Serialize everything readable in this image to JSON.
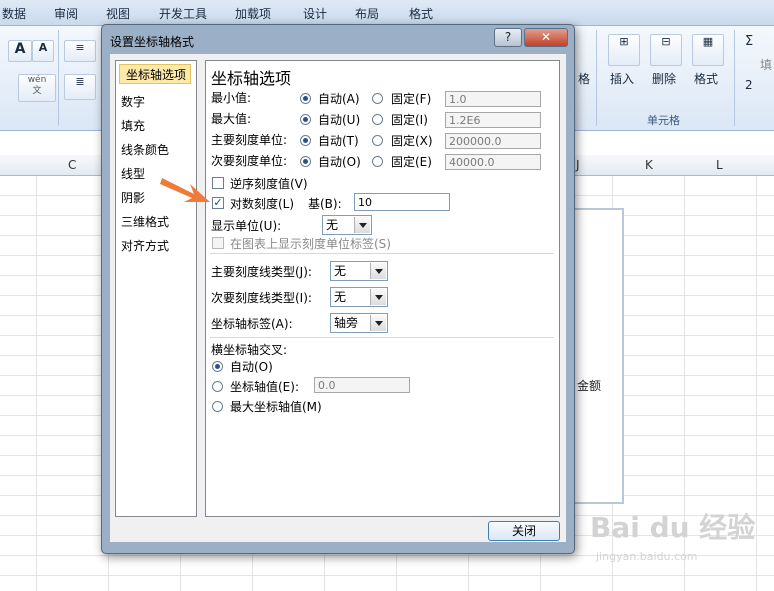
{
  "ribbon": {
    "tabs": [
      "数据",
      "审阅",
      "视图",
      "开发工具",
      "加载项",
      "设计",
      "布局",
      "格式"
    ],
    "font_large": "A",
    "font_small": "A",
    "wen_button": "wén\n文",
    "cells_group": "单元格",
    "insert": "插入",
    "delete": "删除",
    "format": "格式",
    "format_partial": "格",
    "sum_symbol": "Σ",
    "fill_partial": "填",
    "clear_symbol": "2"
  },
  "sheet": {
    "columns": [
      "C",
      "J",
      "K",
      "L"
    ],
    "chart_label": "金额"
  },
  "dialog": {
    "title": "设置坐标轴格式",
    "help": "?",
    "close_x": "✕",
    "categories": [
      "坐标轴选项",
      "数字",
      "填充",
      "线条颜色",
      "线型",
      "阴影",
      "三维格式",
      "对齐方式"
    ],
    "panel_title": "坐标轴选项",
    "rows": [
      {
        "label": "最小值:",
        "auto": "自动(A)",
        "fixed": "固定(F)",
        "value": "1.0"
      },
      {
        "label": "最大值:",
        "auto": "自动(U)",
        "fixed": "固定(I)",
        "value": "1.2E6"
      },
      {
        "label": "主要刻度单位:",
        "auto": "自动(T)",
        "fixed": "固定(X)",
        "value": "200000.0"
      },
      {
        "label": "次要刻度单位:",
        "auto": "自动(O)",
        "fixed": "固定(E)",
        "value": "40000.0"
      }
    ],
    "reverse_order": "逆序刻度值(V)",
    "log_scale": "对数刻度(L)",
    "base_label": "基(B):",
    "base_value": "10",
    "display_units_label": "显示单位(U):",
    "display_units_value": "无",
    "show_units_label": "在图表上显示刻度单位标签(S)",
    "major_tick_label": "主要刻度线类型(J):",
    "major_tick_value": "无",
    "minor_tick_label": "次要刻度线类型(I):",
    "minor_tick_value": "无",
    "axis_labels_label": "坐标轴标签(A):",
    "axis_labels_value": "轴旁",
    "cross_title": "横坐标轴交叉:",
    "cross_auto": "自动(O)",
    "cross_value_label": "坐标轴值(E):",
    "cross_value": "0.0",
    "cross_max": "最大坐标轴值(M)",
    "close_button": "关闭"
  },
  "watermark": {
    "logo": "Bai du 经验",
    "sub": "jingyan.baidu.com"
  },
  "colors": {
    "arrow": "#f07a3a",
    "selected_category": "#fde9a8"
  }
}
